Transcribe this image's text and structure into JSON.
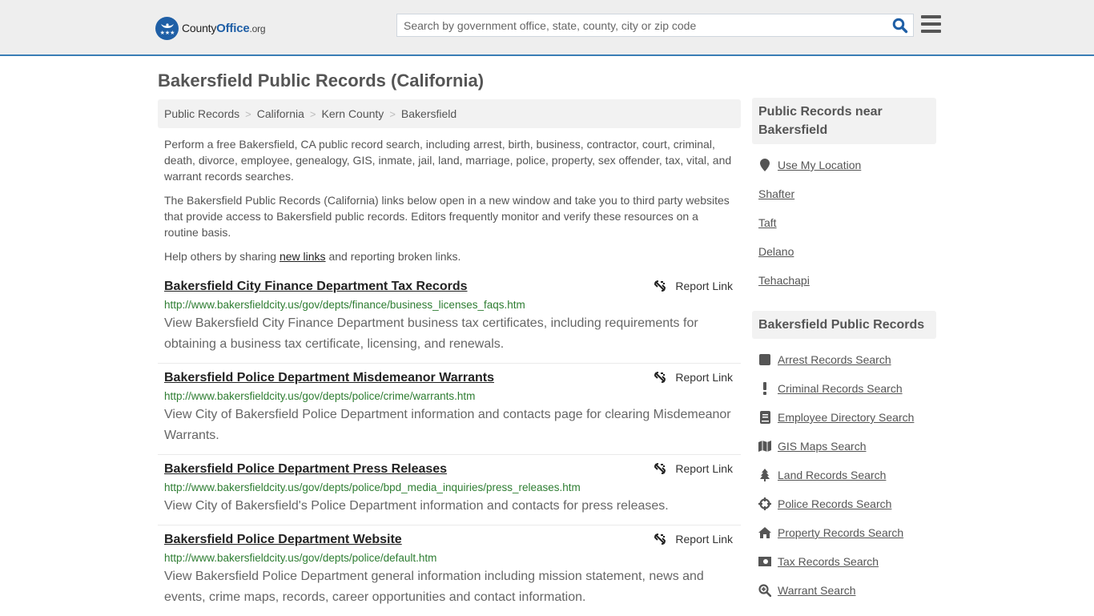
{
  "header": {
    "logo": {
      "name_part1": "County",
      "name_part2": "Office",
      "name_part3": ".org"
    },
    "search": {
      "placeholder": "Search by government office, state, county, city or zip code",
      "value": ""
    },
    "accent_color": "#3a7db5"
  },
  "page": {
    "title": "Bakersfield Public Records (California)"
  },
  "breadcrumb": [
    {
      "label": "Public Records"
    },
    {
      "label": "California"
    },
    {
      "label": "Kern County"
    },
    {
      "label": "Bakersfield"
    }
  ],
  "breadcrumb_separator": ">",
  "intro": {
    "p1": "Perform a free Bakersfield, CA public record search, including arrest, birth, business, contractor, court, criminal, death, divorce, employee, genealogy, GIS, inmate, jail, land, marriage, police, property, sex offender, tax, vital, and warrant records searches.",
    "p2": "The Bakersfield Public Records (California) links below open in a new window and take you to third party websites that provide access to Bakersfield public records. Editors frequently monitor and verify these resources on a routine basis.",
    "p3_before": "Help others by sharing ",
    "p3_link": "new links",
    "p3_after": " and reporting broken links."
  },
  "records": [
    {
      "title": "Bakersfield City Finance Department Tax Records",
      "url": "http://www.bakersfieldcity.us/gov/depts/finance/business_licenses_faqs.htm",
      "description": "View Bakersfield City Finance Department business tax certificates, including requirements for obtaining a business tax certificate, licensing, and renewals.",
      "report_label": "Report Link"
    },
    {
      "title": "Bakersfield Police Department Misdemeanor Warrants",
      "url": "http://www.bakersfieldcity.us/gov/depts/police/crime/warrants.htm",
      "description": "View City of Bakersfield Police Department information and contacts page for clearing Misdemeanor Warrants.",
      "report_label": "Report Link"
    },
    {
      "title": "Bakersfield Police Department Press Releases",
      "url": "http://www.bakersfieldcity.us/gov/depts/police/bpd_media_inquiries/press_releases.htm",
      "description": "View City of Bakersfield's Police Department information and contacts for press releases.",
      "report_label": "Report Link"
    },
    {
      "title": "Bakersfield Police Department Website",
      "url": "http://www.bakersfieldcity.us/gov/depts/police/default.htm",
      "description": "View Bakersfield Police Department general information including mission statement, news and events, crime maps, records, career opportunities and contact information.",
      "report_label": "Report Link"
    }
  ],
  "sidebar": {
    "near": {
      "heading": "Public Records near Bakersfield",
      "use_location": {
        "label": "Use My Location",
        "icon": "map-pin-icon"
      },
      "cities": [
        "Shafter",
        "Taft",
        "Delano",
        "Tehachapi"
      ]
    },
    "records": {
      "heading": "Bakersfield Public Records",
      "items": [
        {
          "label": "Arrest Records Search",
          "icon": "square-icon"
        },
        {
          "label": "Criminal Records Search",
          "icon": "exclamation-icon"
        },
        {
          "label": "Employee Directory Search",
          "icon": "book-icon"
        },
        {
          "label": "GIS Maps Search",
          "icon": "map-icon"
        },
        {
          "label": "Land Records Search",
          "icon": "tree-icon"
        },
        {
          "label": "Police Records Search",
          "icon": "crosshairs-icon"
        },
        {
          "label": "Property Records Search",
          "icon": "home-icon"
        },
        {
          "label": "Tax Records Search",
          "icon": "money-icon"
        },
        {
          "label": "Warrant Search",
          "icon": "search-plus-icon"
        }
      ]
    }
  }
}
